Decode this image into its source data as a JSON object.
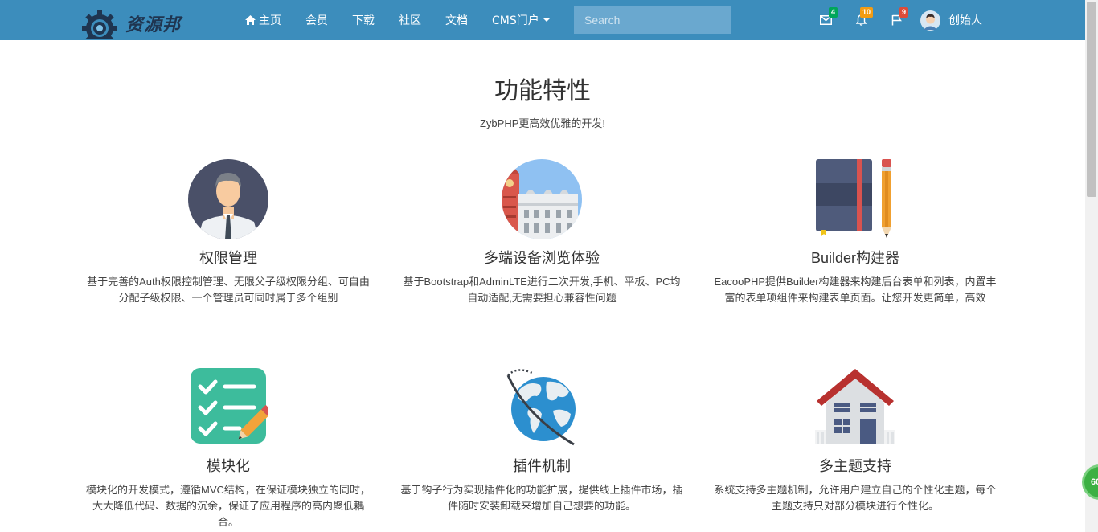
{
  "brand": {
    "logo_text": "资源邦"
  },
  "nav": {
    "items": [
      {
        "label": "主页",
        "icon": "home-icon"
      },
      {
        "label": "会员"
      },
      {
        "label": "下载"
      },
      {
        "label": "社区"
      },
      {
        "label": "文档"
      },
      {
        "label": "CMS门户",
        "dropdown": true
      }
    ]
  },
  "search": {
    "placeholder": "Search",
    "value": ""
  },
  "notifications": {
    "messages": {
      "icon": "envelope-icon",
      "count": "4",
      "color": "#00a65a"
    },
    "alerts": {
      "icon": "bell-icon",
      "count": "10",
      "color": "#f39c12"
    },
    "tasks": {
      "icon": "flag-icon",
      "count": "9",
      "color": "#dd4b39"
    }
  },
  "user": {
    "name": "创始人",
    "avatar": "user-avatar"
  },
  "main": {
    "title": "功能特性",
    "subtitle": "ZybPHP更高效优雅的开发!",
    "features": [
      {
        "icon": "businessman-icon",
        "title": "权限管理",
        "desc": "基于完善的Auth权限控制管理、无限父子级权限分组、可自由分配子级权限、一个管理员可同时属于多个组别"
      },
      {
        "icon": "city-landmark-icon",
        "title": "多端设备浏览体验",
        "desc": "基于Bootstrap和AdminLTE进行二次开发,手机、平板、PC均自动适配,无需要担心兼容性问题"
      },
      {
        "icon": "notebook-pencil-icon",
        "title": "Builder构建器",
        "desc": "EacooPHP提供Builder构建器来构建后台表单和列表，内置丰富的表单项组件来构建表单页面。让您开发更简单，高效"
      },
      {
        "icon": "checklist-icon",
        "title": "模块化",
        "desc": "模块化的开发模式，遵循MVC结构，在保证模块独立的同时，大大降低代码、数据的沉余，保证了应用程序的高内聚低耦合。"
      },
      {
        "icon": "globe-orbit-icon",
        "title": "插件机制",
        "desc": "基于钩子行为实现插件化的功能扩展，提供线上插件市场，插件随时安装卸载来增加自己想要的功能。"
      },
      {
        "icon": "house-icon",
        "title": "多主题支持",
        "desc": "系统支持多主题机制，允许用户建立自己的个性化主题，每个主题支持只对部分模块进行个性化。"
      }
    ]
  },
  "floating": {
    "label": "60"
  },
  "colors": {
    "navbar": "#3c8dbc",
    "accent": "#3c8dbc"
  }
}
